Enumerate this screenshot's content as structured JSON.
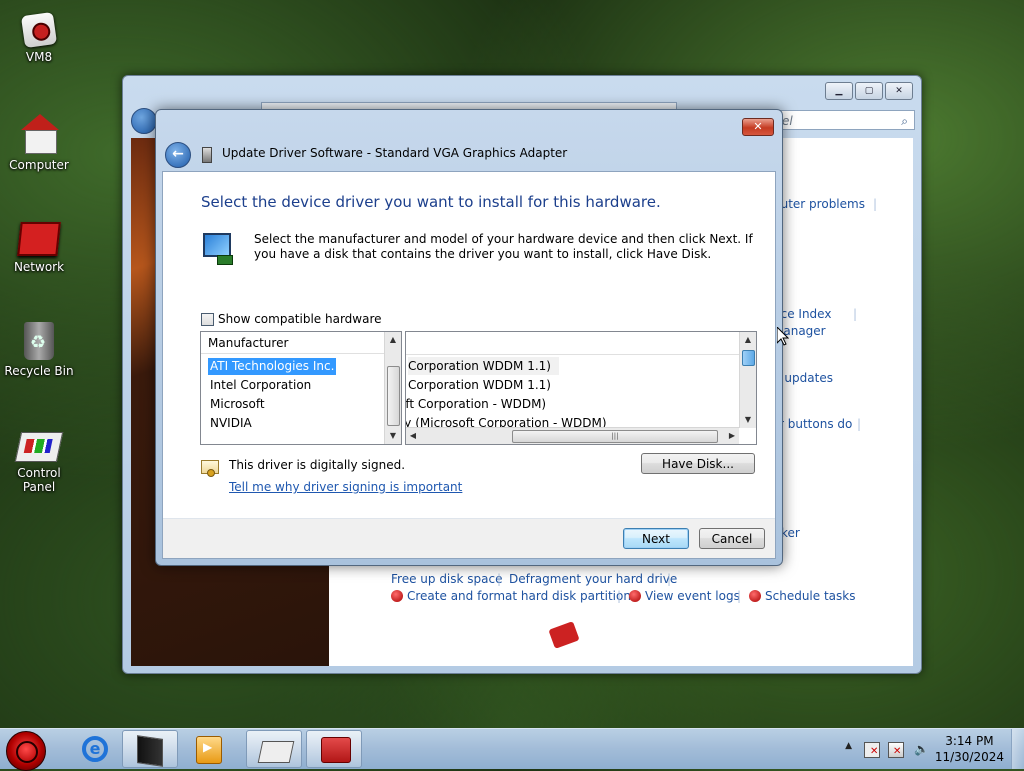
{
  "desktop": {
    "icons": [
      {
        "label": "VM8",
        "icon": "vm8-app-icon"
      },
      {
        "label": "Computer",
        "icon": "computer-icon"
      },
      {
        "label": "Network",
        "icon": "network-icon"
      },
      {
        "label": "Recycle Bin",
        "icon": "recycle-bin-icon"
      },
      {
        "label": "Control Panel",
        "icon": "control-panel-icon"
      }
    ]
  },
  "background_window": {
    "search_placeholder": "el",
    "links": {
      "computer_problems": "puter problems",
      "performance_index": "nce Index",
      "manager": "Manager",
      "updates": "d updates",
      "buttons_do": "r buttons do",
      "ker": "ker",
      "free_disk": "Free up disk space",
      "defragment": "Defragment your hard drive",
      "create_format": "Create and format hard disk partitions",
      "view_event_logs": "View event logs",
      "schedule_tasks": "Schedule tasks"
    }
  },
  "dialog": {
    "title": "Update Driver Software - Standard VGA Graphics Adapter",
    "close_label": "✕",
    "heading": "Select the device driver you want to install for this hardware.",
    "instruction": "Select the manufacturer and model of your hardware device and then click Next. If you have a disk that contains the driver you want to install, click Have Disk.",
    "show_compatible_label": "Show compatible hardware",
    "show_compatible_checked": false,
    "manufacturer_header": "Manufacturer",
    "manufacturers": [
      "ATI Technologies Inc.",
      "Intel Corporation",
      "Microsoft",
      "NVIDIA"
    ],
    "selected_manufacturer": "ATI Technologies Inc.",
    "models": [
      "Corporation WDDM 1.1)",
      "Corporation WDDM 1.1)",
      "oft Corporation - WDDM)",
      "ary (Microsoft Corporation - WDDM)"
    ],
    "signed_text": "This driver is digitally signed.",
    "signing_link": "Tell me why driver signing is important",
    "have_disk_label": "Have Disk...",
    "next_label": "Next",
    "cancel_label": "Cancel",
    "hscroll_grip": "|||"
  },
  "taskbar": {
    "clock_time": "3:14 PM",
    "clock_date": "11/30/2024",
    "tray_chevron": "▲",
    "items": [
      "start-orb",
      "internet-explorer",
      "vm8",
      "media-player",
      "control-panel",
      "toolbox"
    ]
  },
  "colors": {
    "accent_blue": "#1c3f8c",
    "link_blue": "#1f58b0",
    "selection": "#3399ff"
  }
}
